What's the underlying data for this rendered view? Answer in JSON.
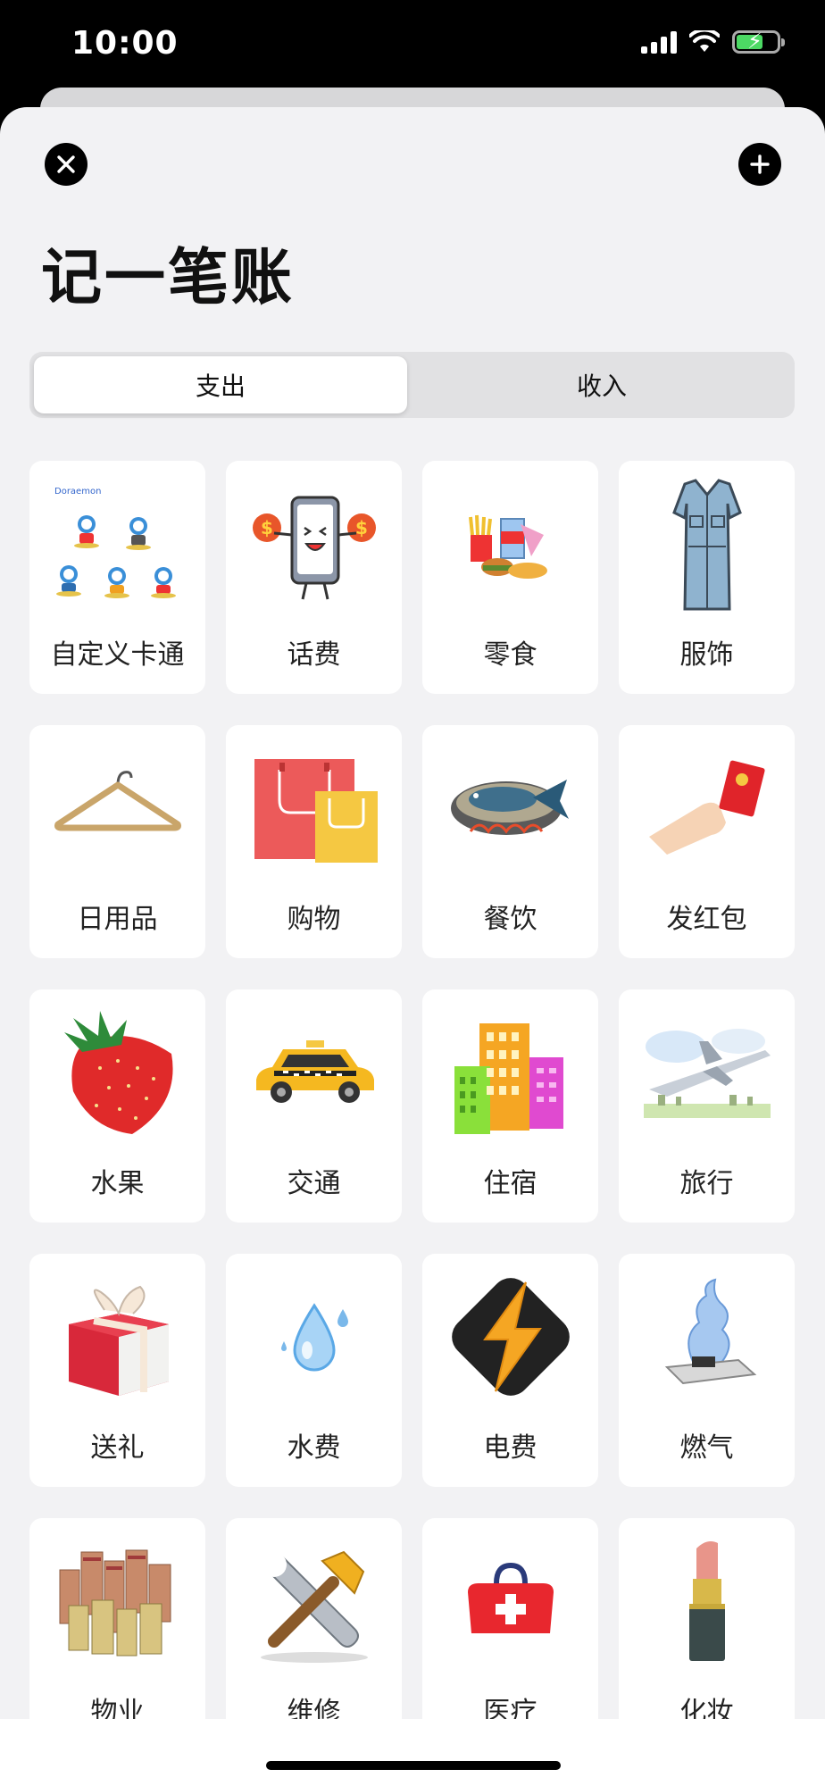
{
  "status_bar": {
    "time": "10:00"
  },
  "header": {
    "title": "记一笔账"
  },
  "tabs": [
    {
      "label": "支出",
      "selected": true
    },
    {
      "label": "收入",
      "selected": false
    }
  ],
  "categories": [
    {
      "label": "自定义卡通",
      "icon": "cartoon-icon"
    },
    {
      "label": "话费",
      "icon": "phone-bill-icon"
    },
    {
      "label": "零食",
      "icon": "snacks-icon"
    },
    {
      "label": "服饰",
      "icon": "dress-icon"
    },
    {
      "label": "日用品",
      "icon": "hanger-icon"
    },
    {
      "label": "购物",
      "icon": "shopping-bag-icon"
    },
    {
      "label": "餐饮",
      "icon": "fish-dish-icon"
    },
    {
      "label": "发红包",
      "icon": "red-envelope-icon"
    },
    {
      "label": "水果",
      "icon": "strawberry-icon"
    },
    {
      "label": "交通",
      "icon": "taxi-icon"
    },
    {
      "label": "住宿",
      "icon": "buildings-icon"
    },
    {
      "label": "旅行",
      "icon": "airplane-icon"
    },
    {
      "label": "送礼",
      "icon": "gift-box-icon"
    },
    {
      "label": "水费",
      "icon": "water-drop-icon"
    },
    {
      "label": "电费",
      "icon": "lightning-icon"
    },
    {
      "label": "燃气",
      "icon": "gas-stove-icon"
    },
    {
      "label": "物业",
      "icon": "city-blocks-icon"
    },
    {
      "label": "维修",
      "icon": "wrench-hammer-icon"
    },
    {
      "label": "医疗",
      "icon": "medical-kit-icon"
    },
    {
      "label": "化妆",
      "icon": "lipstick-icon"
    }
  ],
  "colors": {
    "background": "#f2f2f4",
    "card": "#ffffff",
    "segment_track": "#e1e1e3",
    "accent_black": "#000000"
  }
}
